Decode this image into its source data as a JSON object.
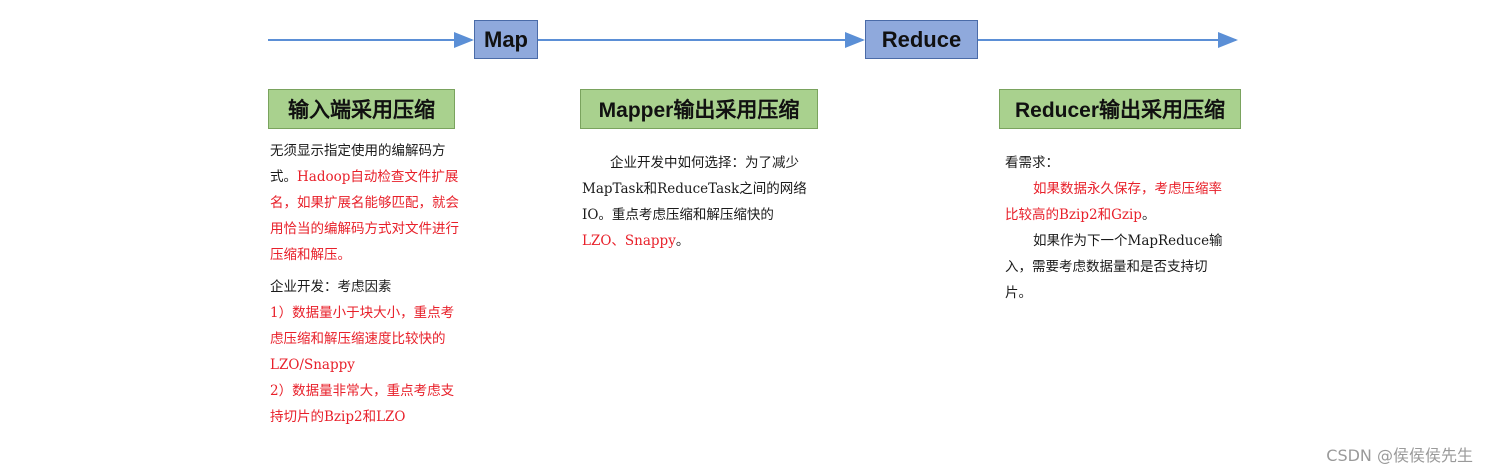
{
  "flow": {
    "stage_map": "Map",
    "stage_reduce": "Reduce"
  },
  "colors": {
    "arrow": "#5b8fd6",
    "stage_fill": "#8fa9dc",
    "header_fill": "#a9d18e",
    "highlight": "#e8202a"
  },
  "sections": {
    "input": {
      "title": "输入端采用压缩",
      "p1_black": "无须显示指定使用的编解码方式。",
      "p1_red": "Hadoop自动检查文件扩展名，如果扩展名能够匹配，就会用恰当的编解码方式对文件进行压缩和解压。",
      "p2": "企业开发：考虑因素",
      "p3": "1）数据量小于块大小，重点考虑压缩和解压缩速度比较快的LZO/Snappy",
      "p4": "2）数据量非常大，重点考虑支持切片的Bzip2和LZO"
    },
    "mapper": {
      "title": "Mapper输出采用压缩",
      "p1_black": "企业开发中如何选择：为了减少MapTask和ReduceTask之间的网络IO。重点考虑压缩和解压缩快的",
      "p1_red": "LZO、Snappy",
      "p1_end": "。"
    },
    "reducer": {
      "title": "Reducer输出采用压缩",
      "p1": "看需求：",
      "p2_red": "如果数据永久保存，考虑压缩率比较高的Bzip2和Gzip",
      "p2_end": "。",
      "p3": "如果作为下一个MapReduce输入，需要考虑数据量和是否支持切片。"
    }
  },
  "watermark": "CSDN @侯侯侯先生"
}
